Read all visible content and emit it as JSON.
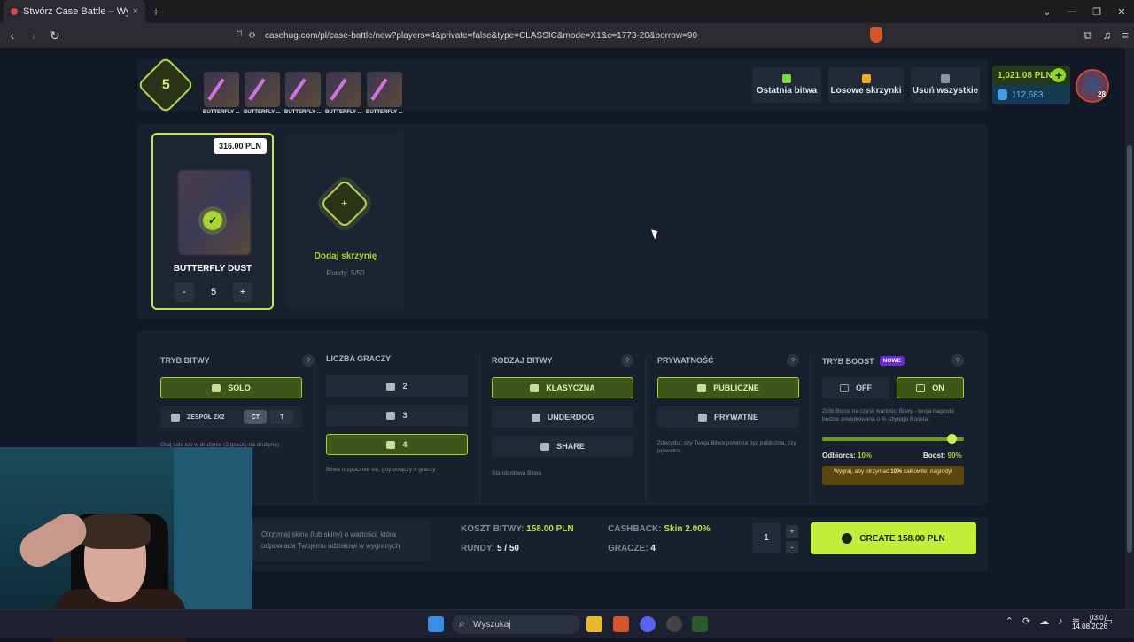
{
  "browser": {
    "tab_title": "Stwórz Case Battle – Wygraj skin",
    "tab_close": "×",
    "new_tab": "+",
    "url": "casehug.com/pl/case-battle/new?players=4&private=false&type=CLASSIC&mode=X1&c=1773-20&borrow=90",
    "window_min": "⌄",
    "window_minimize": "—",
    "window_max": "❐",
    "window_close": "✕"
  },
  "header": {
    "rounds_count": "5",
    "cases": [
      {
        "label": "BUTTERFLY ..."
      },
      {
        "label": "BUTTERFLY ..."
      },
      {
        "label": "BUTTERFLY ..."
      },
      {
        "label": "BUTTERFLY ..."
      },
      {
        "label": "BUTTERFLY ..."
      }
    ],
    "last_battle": "Ostatnia bitwa",
    "random_cases": "Losowe skrzynki",
    "remove_all": "Usuń wszystkie",
    "balance": "1,021.08 PLN",
    "coins": "112,683",
    "level": "28",
    "colors": {
      "accent": "#c3ef3a",
      "last_battle_icon": "#7bd43a",
      "random_icon": "#f0b020",
      "remove_icon": "#8a92a3"
    }
  },
  "case_list": {
    "card": {
      "price": "316.00 PLN",
      "name": "BUTTERFLY DUST",
      "minus": "-",
      "qty": "5",
      "plus": "+"
    },
    "add": {
      "icon": "+",
      "label": "Dodaj skrzynię",
      "rounds": "Rundy: 5/50"
    }
  },
  "options": {
    "mode": {
      "title": "TRYB BITWY",
      "help": "?",
      "solo": "SOLO",
      "team": "ZESPÓŁ 2X2",
      "ct": "CT",
      "t": "T",
      "desc": "Graj solo lub w drużynie (2 graczy na drużynę)"
    },
    "players": {
      "title": "LICZBA GRACZY",
      "opt2": "2",
      "opt3": "3",
      "opt4": "4",
      "desc": "Bitwa rozpocznie się, gdy dołączy 4 graczy"
    },
    "type": {
      "title": "RODZAJ BITWY",
      "help": "?",
      "classic": "KLASYCZNA",
      "underdog": "UNDERDOG",
      "share": "SHARE",
      "desc": "Standardowa Bitwa"
    },
    "privacy": {
      "title": "PRYWATNOŚĆ",
      "help": "?",
      "public": "PUBLICZNE",
      "private": "PRYWATNE",
      "desc": "Zdecyduj, czy Twoja Bitwa powinna być publiczna, czy prywatna."
    },
    "boost": {
      "title": "TRYB BOOST",
      "badge": "NOWE",
      "help": "?",
      "off": "OFF",
      "on": "ON",
      "desc": "Zrób Boost na część wartości Bitwy - twoja nagroda będzie zredukowana o % użytego Boosta.",
      "level": 0.9,
      "receiver_label": "Odbiorca:",
      "receiver_val": "10%",
      "boost_label": "Boost:",
      "boost_val": "90%",
      "note_a": "Wygraj, aby otrzymać ",
      "note_b": "10%",
      "note_c": " całkowitej nagrody!"
    }
  },
  "summary": {
    "desc": "Otrzymaj skina (lub skiny) o wartości, która odpowiada Twojemu udziałowi w wygranych",
    "cost_label": "KOSZT BITWY:",
    "cost": "158.00 PLN",
    "rounds_label": "RUNDY:",
    "rounds": "5 / 50",
    "cashback_label": "CASHBACK:",
    "cashback": "Skin 2.00%",
    "players_label": "GRACZE:",
    "players": "4",
    "count": "1",
    "plus": "+",
    "minus": "-",
    "create": "CREATE 158.00 PLN"
  },
  "taskbar": {
    "search": "Wyszukaj",
    "time": "03:07",
    "date": "14.08.2026"
  }
}
